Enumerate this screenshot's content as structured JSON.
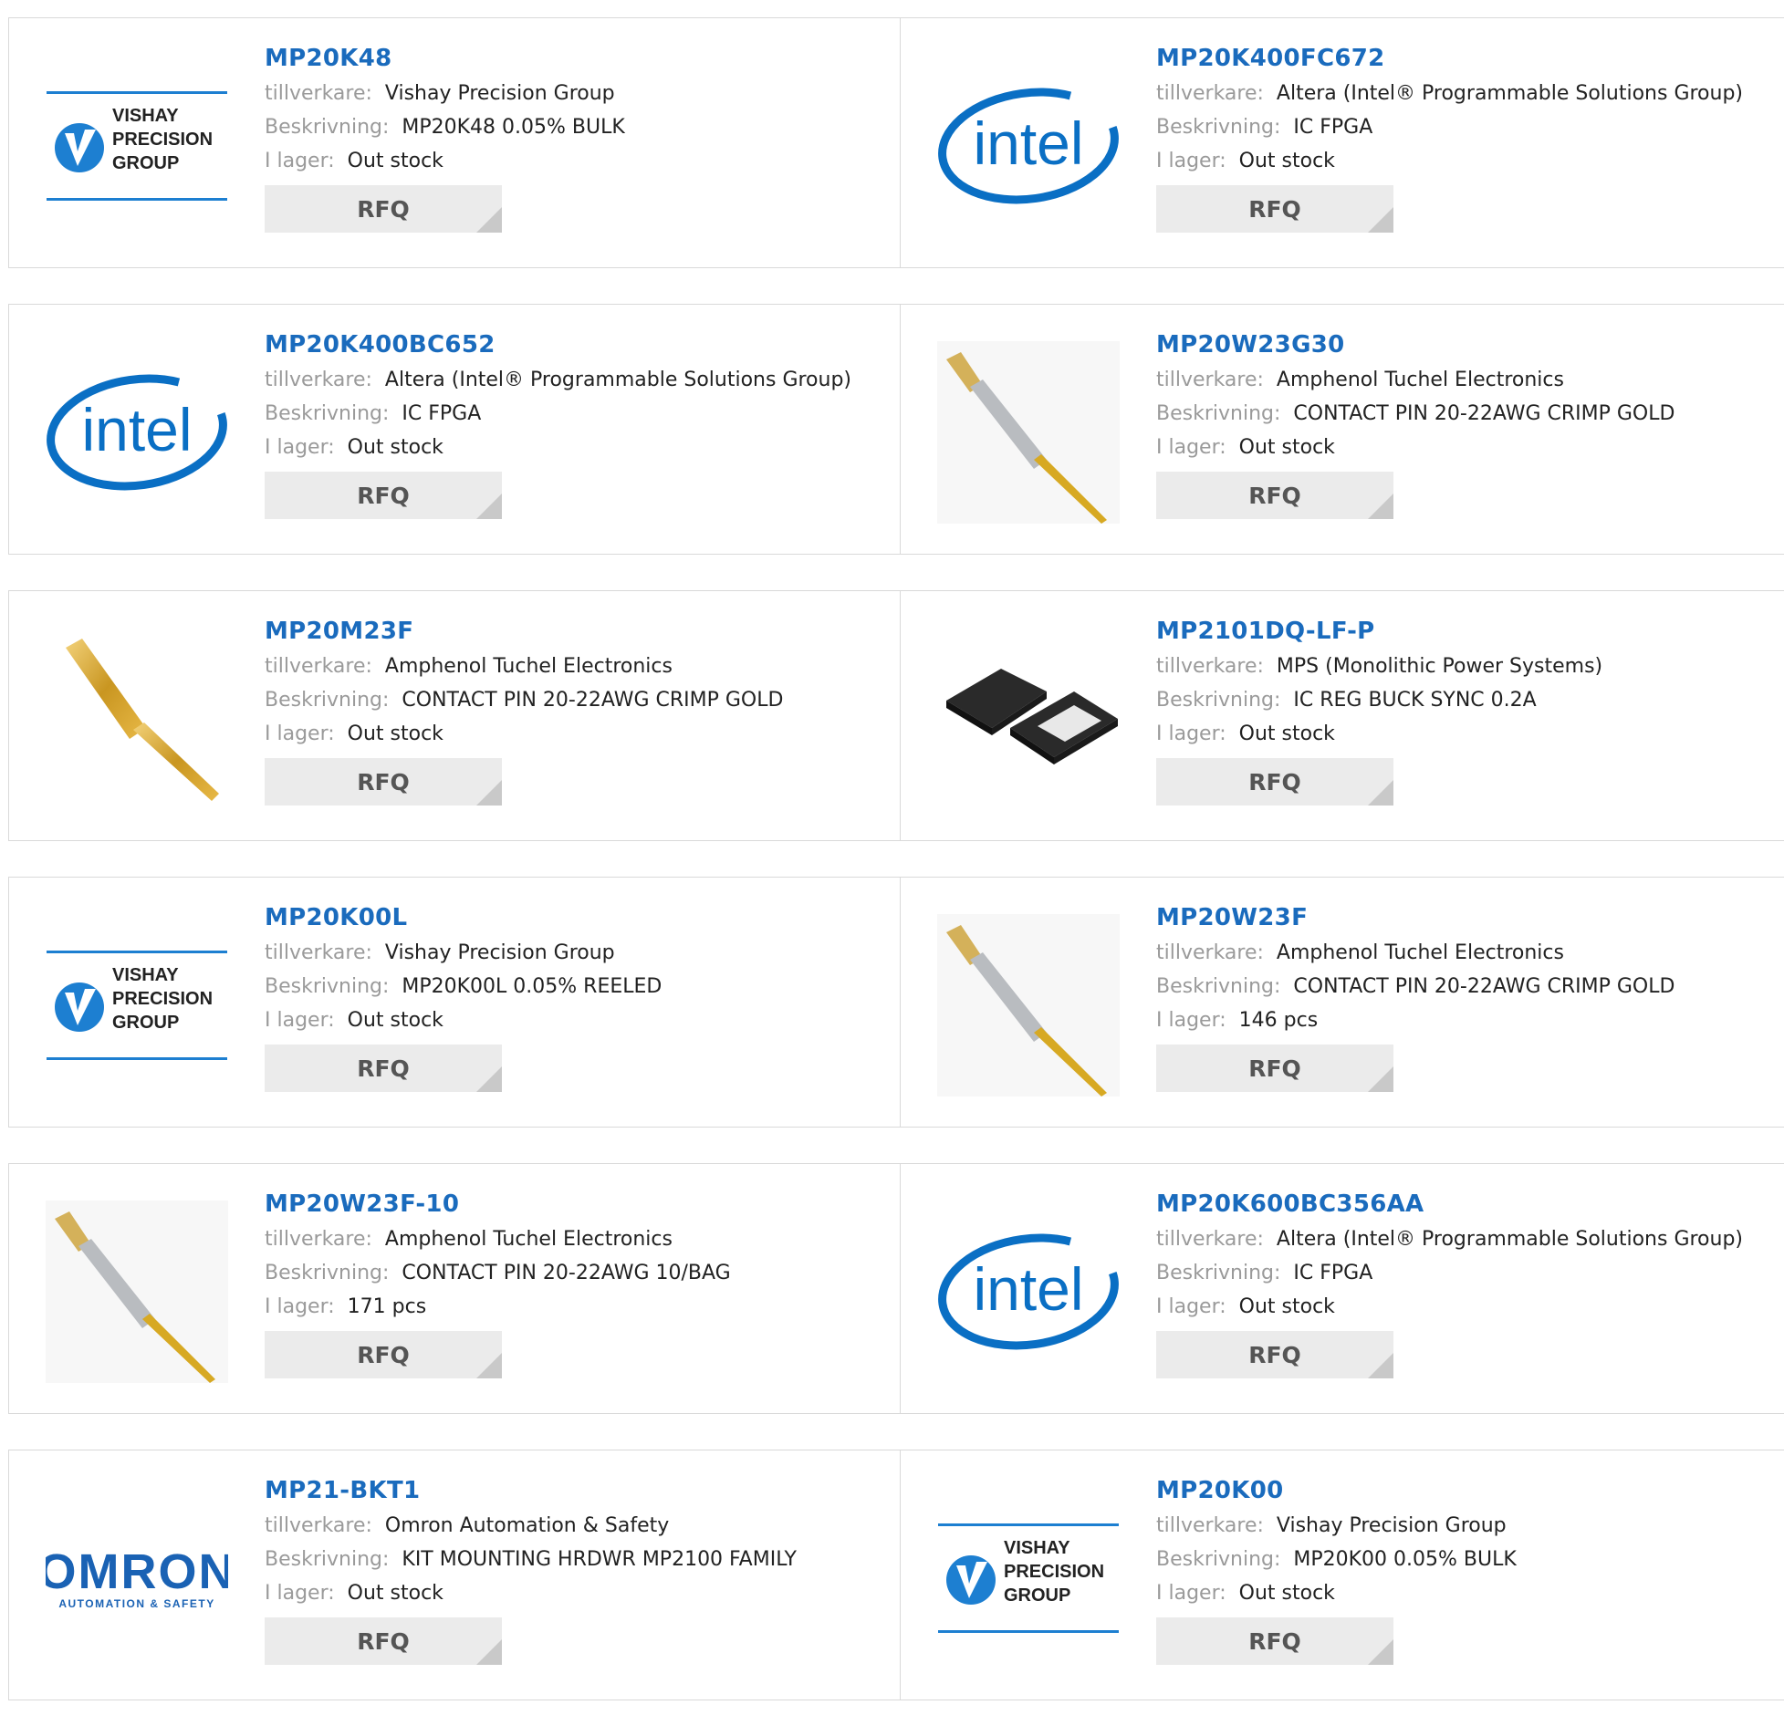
{
  "labels": {
    "manufacturer": "tillverkare:",
    "description": "Beskrivning:",
    "stock": "I lager:",
    "rfq": "RFQ"
  },
  "logos": {
    "vishay": [
      "VISHAY",
      "PRECISION",
      "GROUP"
    ],
    "intel": "intel",
    "omron": "OMRON",
    "omron_sub": "AUTOMATION & SAFETY"
  },
  "colors": {
    "part_link": "#1a6bbd",
    "label": "#9a9a9a",
    "rfq_bg": "#ebebeb",
    "vishay_blue": "#1d7fd1",
    "intel_blue": "#0a6fc4"
  },
  "products": [
    {
      "part": "MP20K48",
      "manufacturer": "Vishay Precision Group",
      "description": "MP20K48 0.05% BULK",
      "stock": "Out stock",
      "image": "vishay-logo"
    },
    {
      "part": "MP20K400FC672",
      "manufacturer": "Altera (Intel® Programmable Solutions Group)",
      "description": "IC FPGA",
      "stock": "Out stock",
      "image": "intel-logo"
    },
    {
      "part": "MP20K400BC652",
      "manufacturer": "Altera (Intel® Programmable Solutions Group)",
      "description": "IC FPGA",
      "stock": "Out stock",
      "image": "intel-logo"
    },
    {
      "part": "MP20W23G30",
      "manufacturer": "Amphenol Tuchel Electronics",
      "description": "CONTACT PIN 20-22AWG CRIMP GOLD",
      "stock": "Out stock",
      "image": "contact-pin-silver"
    },
    {
      "part": "MP20M23F",
      "manufacturer": "Amphenol Tuchel Electronics",
      "description": "CONTACT PIN 20-22AWG CRIMP GOLD",
      "stock": "Out stock",
      "image": "contact-pin-gold"
    },
    {
      "part": "MP2101DQ-LF-P",
      "manufacturer": "MPS (Monolithic Power Systems)",
      "description": "IC REG BUCK SYNC 0.2A",
      "stock": "Out stock",
      "image": "ic-chip"
    },
    {
      "part": "MP20K00L",
      "manufacturer": "Vishay Precision Group",
      "description": "MP20K00L 0.05% REELED",
      "stock": "Out stock",
      "image": "vishay-logo"
    },
    {
      "part": "MP20W23F",
      "manufacturer": "Amphenol Tuchel Electronics",
      "description": "CONTACT PIN 20-22AWG CRIMP GOLD",
      "stock": "146 pcs",
      "image": "contact-pin-silver"
    },
    {
      "part": "MP20W23F-10",
      "manufacturer": "Amphenol Tuchel Electronics",
      "description": "CONTACT PIN 20-22AWG 10/BAG",
      "stock": "171 pcs",
      "image": "contact-pin-silver"
    },
    {
      "part": "MP20K600BC356AA",
      "manufacturer": "Altera (Intel® Programmable Solutions Group)",
      "description": "IC FPGA",
      "stock": "Out stock",
      "image": "intel-logo"
    },
    {
      "part": "MP21-BKT1",
      "manufacturer": "Omron Automation & Safety",
      "description": "KIT MOUNTING HRDWR MP2100 FAMILY",
      "stock": "Out stock",
      "image": "omron-logo"
    },
    {
      "part": "MP20K00",
      "manufacturer": "Vishay Precision Group",
      "description": "MP20K00 0.05% BULK",
      "stock": "Out stock",
      "image": "vishay-logo"
    }
  ]
}
